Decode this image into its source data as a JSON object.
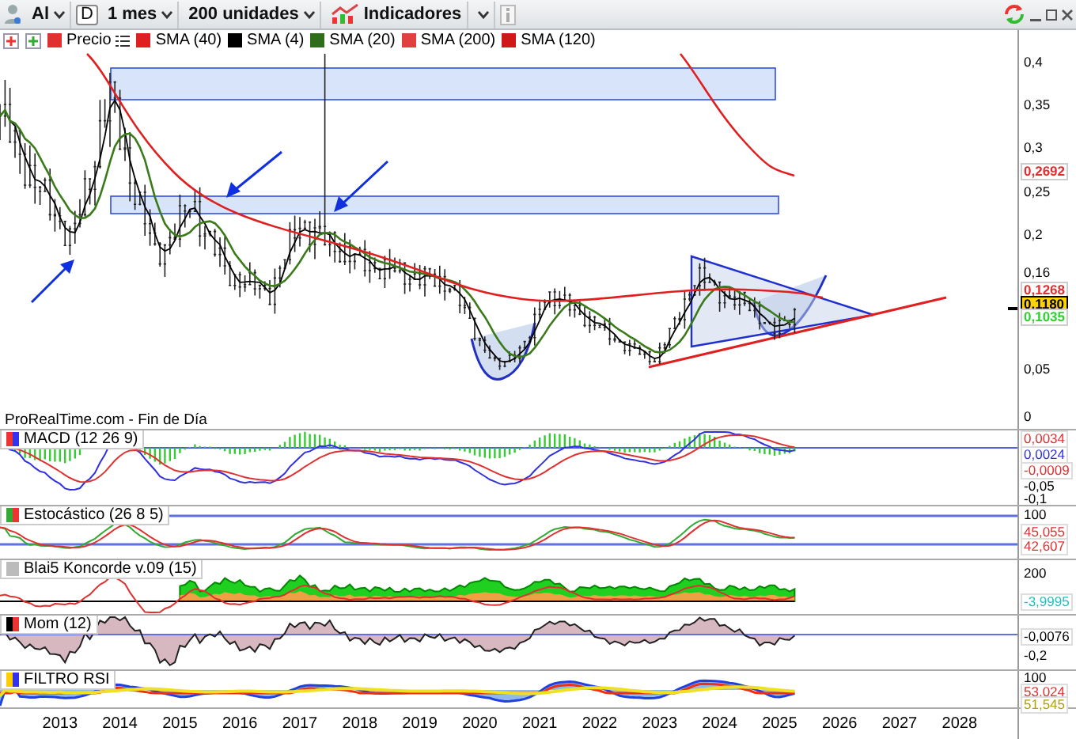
{
  "toolbar": {
    "instrument": "Al",
    "period_button": "D",
    "timeframe": "1 mes",
    "units": "200 unidades",
    "indicators_button": "Indicadores"
  },
  "legend": [
    {
      "label": "Precio",
      "color": "#e03030"
    },
    {
      "label": "SMA (40)",
      "color": "#e02020"
    },
    {
      "label": "SMA (4)",
      "color": "#000000"
    },
    {
      "label": "SMA (20)",
      "color": "#2e6e1a"
    },
    {
      "label": "SMA (200)",
      "color": "#e04040"
    },
    {
      "label": "SMA (120)",
      "color": "#d01818"
    }
  ],
  "chart": {
    "source": "ProRealTime.com - Fin de Día",
    "y_axis_labels": [
      "0,4",
      "0,35",
      "0,3",
      "0,25",
      "0,2",
      "0,16",
      "0,05",
      "0"
    ],
    "price_tags": [
      {
        "text": "0,2692",
        "kind": "level",
        "color": "#e03030"
      },
      {
        "text": "0,1268",
        "kind": "level",
        "color": "#e03030"
      },
      {
        "text": "0,1180",
        "kind": "current",
        "color": "#000000"
      },
      {
        "text": "0,1035",
        "kind": "level",
        "color": "#30d030"
      }
    ]
  },
  "panels": [
    {
      "kind": "macd",
      "title": "MACD (12 26 9)",
      "axis_labels": [
        "-0,05",
        "-0,1"
      ],
      "value_tags": [
        {
          "text": "0,0034",
          "color": "#e03030"
        },
        {
          "text": "0,0024",
          "color": "#3030e0"
        },
        {
          "text": "-0,0009",
          "color": "#e03030"
        }
      ]
    },
    {
      "kind": "stochastic",
      "title": "Estocástico (26 8 5)",
      "axis_labels": [
        "100"
      ],
      "value_tags": [
        {
          "text": "45,055",
          "color": "#e03030"
        },
        {
          "text": "42,607",
          "color": "#e03030"
        }
      ]
    },
    {
      "kind": "koncorde",
      "title": "Blai5 Koncorde v.09 (15)",
      "axis_labels": [
        "200"
      ],
      "value_tags": [
        {
          "text": "-3,9995",
          "color": "#20c0c0"
        }
      ]
    },
    {
      "kind": "momentum",
      "title": "Mom (12)",
      "axis_labels": [
        "-0,2"
      ],
      "value_tags": [
        {
          "text": "-0,0076",
          "color": "#000000"
        }
      ]
    },
    {
      "kind": "rsi",
      "title": "FILTRO RSI",
      "axis_labels": [
        "100"
      ],
      "value_tags": [
        {
          "text": "53,024",
          "color": "#e03030"
        },
        {
          "text": "51,545",
          "color": "#b0a000"
        }
      ]
    }
  ],
  "x_axis": [
    "2013",
    "2014",
    "2015",
    "2016",
    "2017",
    "2018",
    "2019",
    "2020",
    "2021",
    "2022",
    "2023",
    "2024",
    "2025",
    "2026",
    "2027",
    "2028"
  ]
}
